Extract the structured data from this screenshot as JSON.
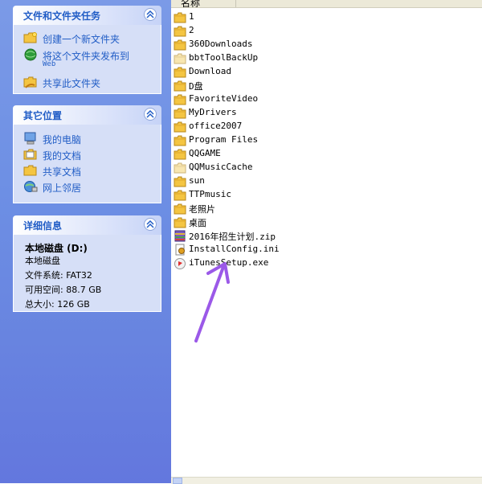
{
  "sidebar": {
    "tasks_panel": {
      "title": "文件和文件夹任务",
      "items": [
        {
          "label": "创建一个新文件夹",
          "icon": "new-folder-icon"
        },
        {
          "label": "将这个文件夹发布到",
          "label2": "Web",
          "icon": "publish-web-icon"
        },
        {
          "label": "共享此文件夹",
          "icon": "share-folder-icon"
        }
      ]
    },
    "places_panel": {
      "title": "其它位置",
      "items": [
        {
          "label": "我的电脑",
          "icon": "my-computer-icon"
        },
        {
          "label": "我的文档",
          "icon": "my-documents-icon"
        },
        {
          "label": "共享文档",
          "icon": "shared-documents-icon"
        },
        {
          "label": "网上邻居",
          "icon": "network-places-icon"
        }
      ]
    },
    "details_panel": {
      "title": "详细信息",
      "drive_name": "本地磁盘 (D:)",
      "drive_type": "本地磁盘",
      "filesystem": "文件系统: FAT32",
      "free_space": "可用空间: 88.7 GB",
      "total_size": "总大小: 126 GB"
    }
  },
  "filelist": {
    "column_header": "名称",
    "items": [
      {
        "name": "1",
        "type": "folder"
      },
      {
        "name": "2",
        "type": "folder"
      },
      {
        "name": "360Downloads",
        "type": "folder"
      },
      {
        "name": "bbtToolBackUp",
        "type": "folder-light"
      },
      {
        "name": "Download",
        "type": "folder"
      },
      {
        "name": "D盘",
        "type": "folder"
      },
      {
        "name": "FavoriteVideo",
        "type": "folder"
      },
      {
        "name": "MyDrivers",
        "type": "folder"
      },
      {
        "name": "office2007",
        "type": "folder"
      },
      {
        "name": "Program Files",
        "type": "folder"
      },
      {
        "name": "QQGAME",
        "type": "folder"
      },
      {
        "name": "QQMusicCache",
        "type": "folder-light"
      },
      {
        "name": "sun",
        "type": "folder"
      },
      {
        "name": "TTPmusic",
        "type": "folder"
      },
      {
        "name": "老照片",
        "type": "folder"
      },
      {
        "name": "桌面",
        "type": "folder"
      },
      {
        "name": "2016年招生计划.zip",
        "type": "zip"
      },
      {
        "name": "InstallConfig.ini",
        "type": "ini"
      },
      {
        "name": "iTunesSetup.exe",
        "type": "exe"
      }
    ]
  },
  "colors": {
    "sidebar_bg": "#6d8fe4",
    "panel_title": "#215dc6",
    "panel_body": "#d6dff7",
    "folder": "#f4c542",
    "annotation_arrow": "#9b59e8"
  }
}
